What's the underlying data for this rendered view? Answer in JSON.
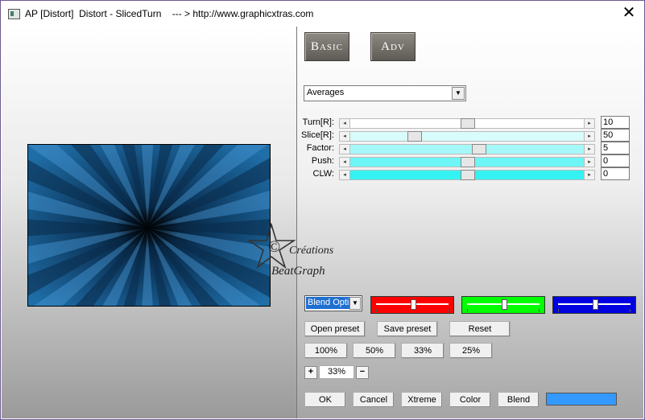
{
  "window": {
    "title": "AP [Distort]  Distort - SlicedTurn    --- > http://www.graphicxtras.com"
  },
  "tabs": [
    {
      "label": "Basic"
    },
    {
      "label": "Adv"
    }
  ],
  "mode_select": {
    "value": "Averages"
  },
  "sliders": [
    {
      "label": "Turn[R]:",
      "value": "10",
      "position": 0.5,
      "track_color": "#ffffff"
    },
    {
      "label": "Slice[R]:",
      "value": "50",
      "position": 0.26,
      "track_color": "#d8fbfb"
    },
    {
      "label": "Factor:",
      "value": "5",
      "position": 0.55,
      "track_color": "#a6f8f8"
    },
    {
      "label": "Push:",
      "value": "0",
      "position": 0.5,
      "track_color": "#6ef5f5"
    },
    {
      "label": "CLW:",
      "value": "0",
      "position": 0.5,
      "track_color": "#34f2f2"
    }
  ],
  "blend": {
    "dropdown_value": "Blend Opti",
    "channels": [
      {
        "name": "red",
        "color": "#ff0000",
        "position": 0.5
      },
      {
        "name": "green",
        "color": "#00ff00",
        "position": 0.5
      },
      {
        "name": "blue",
        "color": "#0000e0",
        "position": 0.5
      }
    ]
  },
  "preset_buttons": {
    "open": "Open preset",
    "save": "Save preset",
    "reset": "Reset"
  },
  "zoom_buttons": [
    "100%",
    "50%",
    "33%",
    "25%"
  ],
  "zoom": {
    "value": "33%",
    "plus": "+",
    "minus": "−"
  },
  "bottom_buttons": {
    "ok": "OK",
    "cancel": "Cancel",
    "xtreme": "Xtreme",
    "color": "Color",
    "blend": "Blend"
  },
  "color_swatch": "#3399ff",
  "watermark": {
    "line1": "Créations",
    "line2": "BeatGraph",
    "symbol": "©"
  }
}
